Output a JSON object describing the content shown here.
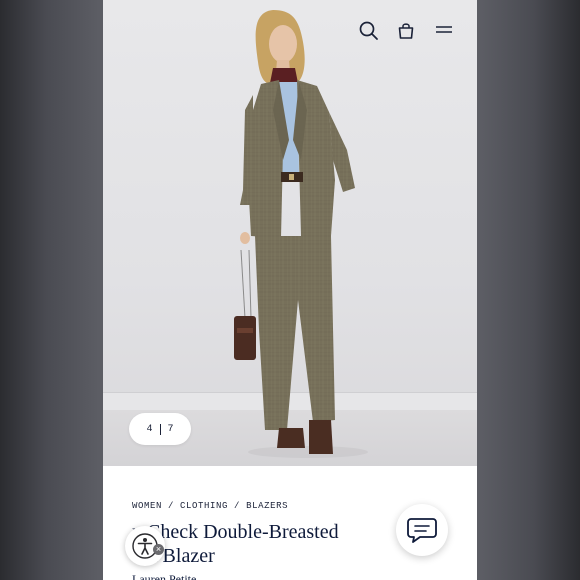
{
  "header": {
    "icons": [
      "search-icon",
      "shopping-bag-icon",
      "menu-icon"
    ]
  },
  "gallery": {
    "current": "4",
    "total": "7"
  },
  "breadcrumb": {
    "items": [
      "WOMEN",
      "CLOTHING",
      "BLAZERS"
    ],
    "separator": "/"
  },
  "product": {
    "title_line1": "n Check Double-Breasted",
    "title_line2": "ool Blazer",
    "brand_line": "Lauren Petite"
  },
  "colors": {
    "ink": "#0e1a3a",
    "jacket": "#77705a",
    "shirt": "#a9c3e0",
    "scarf": "#5a1f22"
  },
  "floating": {
    "chat_icon": "chat-bubble-icon",
    "accessibility_icon": "accessibility-icon",
    "dismiss_glyph": "×"
  }
}
